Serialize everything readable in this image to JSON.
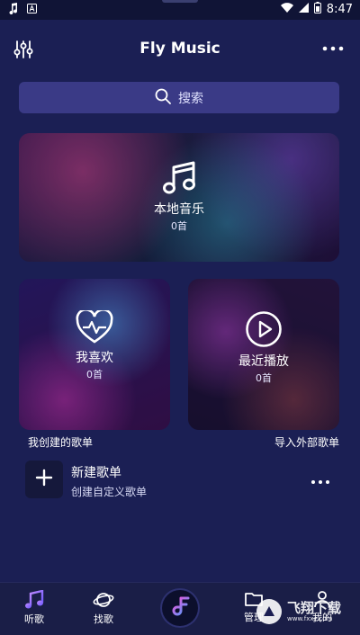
{
  "status_bar": {
    "time": "8:47",
    "icons": [
      "music-note-icon",
      "text-a-icon",
      "wifi-icon",
      "signal-icon",
      "battery-icon"
    ]
  },
  "header": {
    "title": "Fly Music",
    "left_icon": "equalizer-icon",
    "right_icon": "more-icon"
  },
  "search": {
    "placeholder": "搜索"
  },
  "cards": {
    "local": {
      "label": "本地音乐",
      "count": "0首"
    },
    "favorites": {
      "label": "我喜欢",
      "count": "0首"
    },
    "recent": {
      "label": "最近播放",
      "count": "0首"
    }
  },
  "sections": {
    "created": "我创建的歌单",
    "import": "导入外部歌单"
  },
  "playlist_new": {
    "title": "新建歌单",
    "subtitle": "创建自定义歌单"
  },
  "bottom_nav": {
    "listen": "听歌",
    "discover": "找歌",
    "manage": "管理",
    "profile": "我的"
  },
  "watermark": {
    "brand": "飞翔下载",
    "url": "www.fxxz.com"
  },
  "colors": {
    "background": "#1b1f54",
    "search_bg": "#3a3a86",
    "nav_bg": "#1a1e47",
    "accent": "#a56bff"
  }
}
